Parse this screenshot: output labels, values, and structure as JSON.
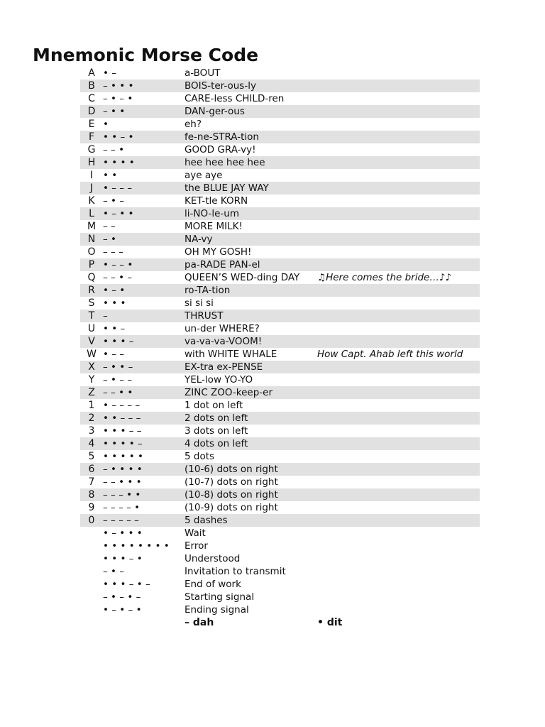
{
  "title": "Mnemonic Morse Code",
  "rows": [
    {
      "letter": "A",
      "code": "• –",
      "mnemonic": "a-BOUT",
      "note": ""
    },
    {
      "letter": "B",
      "code": "– • • •",
      "mnemonic": "BOIS-ter-ous-ly",
      "note": ""
    },
    {
      "letter": "C",
      "code": "– • – •",
      "mnemonic": "CARE-less CHILD-ren",
      "note": ""
    },
    {
      "letter": "D",
      "code": "– • •",
      "mnemonic": "DAN-ger-ous",
      "note": ""
    },
    {
      "letter": "E",
      "code": "•",
      "mnemonic": "eh?",
      "note": ""
    },
    {
      "letter": "F",
      "code": "• • – •",
      "mnemonic": "fe-ne-STRA-tion",
      "note": ""
    },
    {
      "letter": "G",
      "code": "– – •",
      "mnemonic": "GOOD GRA-vy!",
      "note": ""
    },
    {
      "letter": "H",
      "code": "• • • •",
      "mnemonic": "hee hee hee hee",
      "note": ""
    },
    {
      "letter": "I",
      "code": "• •",
      "mnemonic": "aye aye",
      "note": ""
    },
    {
      "letter": "J",
      "code": "• – – –",
      "mnemonic": "the BLUE JAY WAY",
      "note": ""
    },
    {
      "letter": "K",
      "code": "– • –",
      "mnemonic": "KET-tle KORN",
      "note": ""
    },
    {
      "letter": "L",
      "code": "• – • •",
      "mnemonic": "li-NO-le-um",
      "note": ""
    },
    {
      "letter": "M",
      "code": "– –",
      "mnemonic": "MORE MILK!",
      "note": ""
    },
    {
      "letter": "N",
      "code": "– •",
      "mnemonic": "NA-vy",
      "note": ""
    },
    {
      "letter": "O",
      "code": "– – –",
      "mnemonic": "OH MY GOSH!",
      "note": ""
    },
    {
      "letter": "P",
      "code": "• – – •",
      "mnemonic": "pa-RADE PAN-el",
      "note": ""
    },
    {
      "letter": "Q",
      "code": "– – • –",
      "mnemonic": "QUEEN’S WED-ding DAY",
      "note": "♫Here comes the bride…♪♪"
    },
    {
      "letter": "R",
      "code": "• – •",
      "mnemonic": "ro-TA-tion",
      "note": ""
    },
    {
      "letter": "S",
      "code": "• • •",
      "mnemonic": "si si si",
      "note": ""
    },
    {
      "letter": "T",
      "code": "–",
      "mnemonic": "THRUST",
      "note": ""
    },
    {
      "letter": "U",
      "code": "• • –",
      "mnemonic": "un-der WHERE?",
      "note": ""
    },
    {
      "letter": "V",
      "code": "• • • –",
      "mnemonic": "va-va-va-VOOM!",
      "note": ""
    },
    {
      "letter": "W",
      "code": "• – –",
      "mnemonic": "with WHITE WHALE",
      "note": "How Capt. Ahab left this world"
    },
    {
      "letter": "X",
      "code": "– • • –",
      "mnemonic": "EX-tra ex-PENSE",
      "note": ""
    },
    {
      "letter": "Y",
      "code": "– • – –",
      "mnemonic": "YEL-low YO-YO",
      "note": ""
    },
    {
      "letter": "Z",
      "code": "– – • •",
      "mnemonic": "ZINC ZOO-keep-er",
      "note": ""
    },
    {
      "letter": "1",
      "code": "• – – – –",
      "mnemonic": "1 dot on left",
      "note": ""
    },
    {
      "letter": "2",
      "code": "• • – – –",
      "mnemonic": "2 dots on left",
      "note": ""
    },
    {
      "letter": "3",
      "code": "• • • – –",
      "mnemonic": "3 dots on left",
      "note": ""
    },
    {
      "letter": "4",
      "code": "• • • • –",
      "mnemonic": "4 dots on left",
      "note": ""
    },
    {
      "letter": "5",
      "code": "• • • • •",
      "mnemonic": "5 dots",
      "note": ""
    },
    {
      "letter": "6",
      "code": "– • • • •",
      "mnemonic": "(10-6) dots on right",
      "note": ""
    },
    {
      "letter": "7",
      "code": "– – • • •",
      "mnemonic": "(10-7) dots on right",
      "note": ""
    },
    {
      "letter": "8",
      "code": "– – – • •",
      "mnemonic": "(10-8) dots on right",
      "note": ""
    },
    {
      "letter": "9",
      "code": "– – – – •",
      "mnemonic": "(10-9) dots on right",
      "note": ""
    },
    {
      "letter": "0",
      "code": "– – – – –",
      "mnemonic": "5 dashes",
      "note": ""
    },
    {
      "letter": "",
      "code": "• – • • •",
      "mnemonic": "Wait",
      "note": ""
    },
    {
      "letter": "",
      "code": "• • • • • • • •",
      "mnemonic": "Error",
      "note": ""
    },
    {
      "letter": "",
      "code": "• • • – •",
      "mnemonic": "Understood",
      "note": ""
    },
    {
      "letter": "",
      "code": "– • –",
      "mnemonic": "Invitation to transmit",
      "note": ""
    },
    {
      "letter": "",
      "code": "• • • – • –",
      "mnemonic": "End of work",
      "note": ""
    },
    {
      "letter": "",
      "code": "– • – • –",
      "mnemonic": "Starting signal",
      "note": ""
    },
    {
      "letter": "",
      "code": "• – • – •",
      "mnemonic": "Ending signal",
      "note": ""
    }
  ],
  "legend": {
    "dah": "– dah",
    "dit": "• dit"
  }
}
